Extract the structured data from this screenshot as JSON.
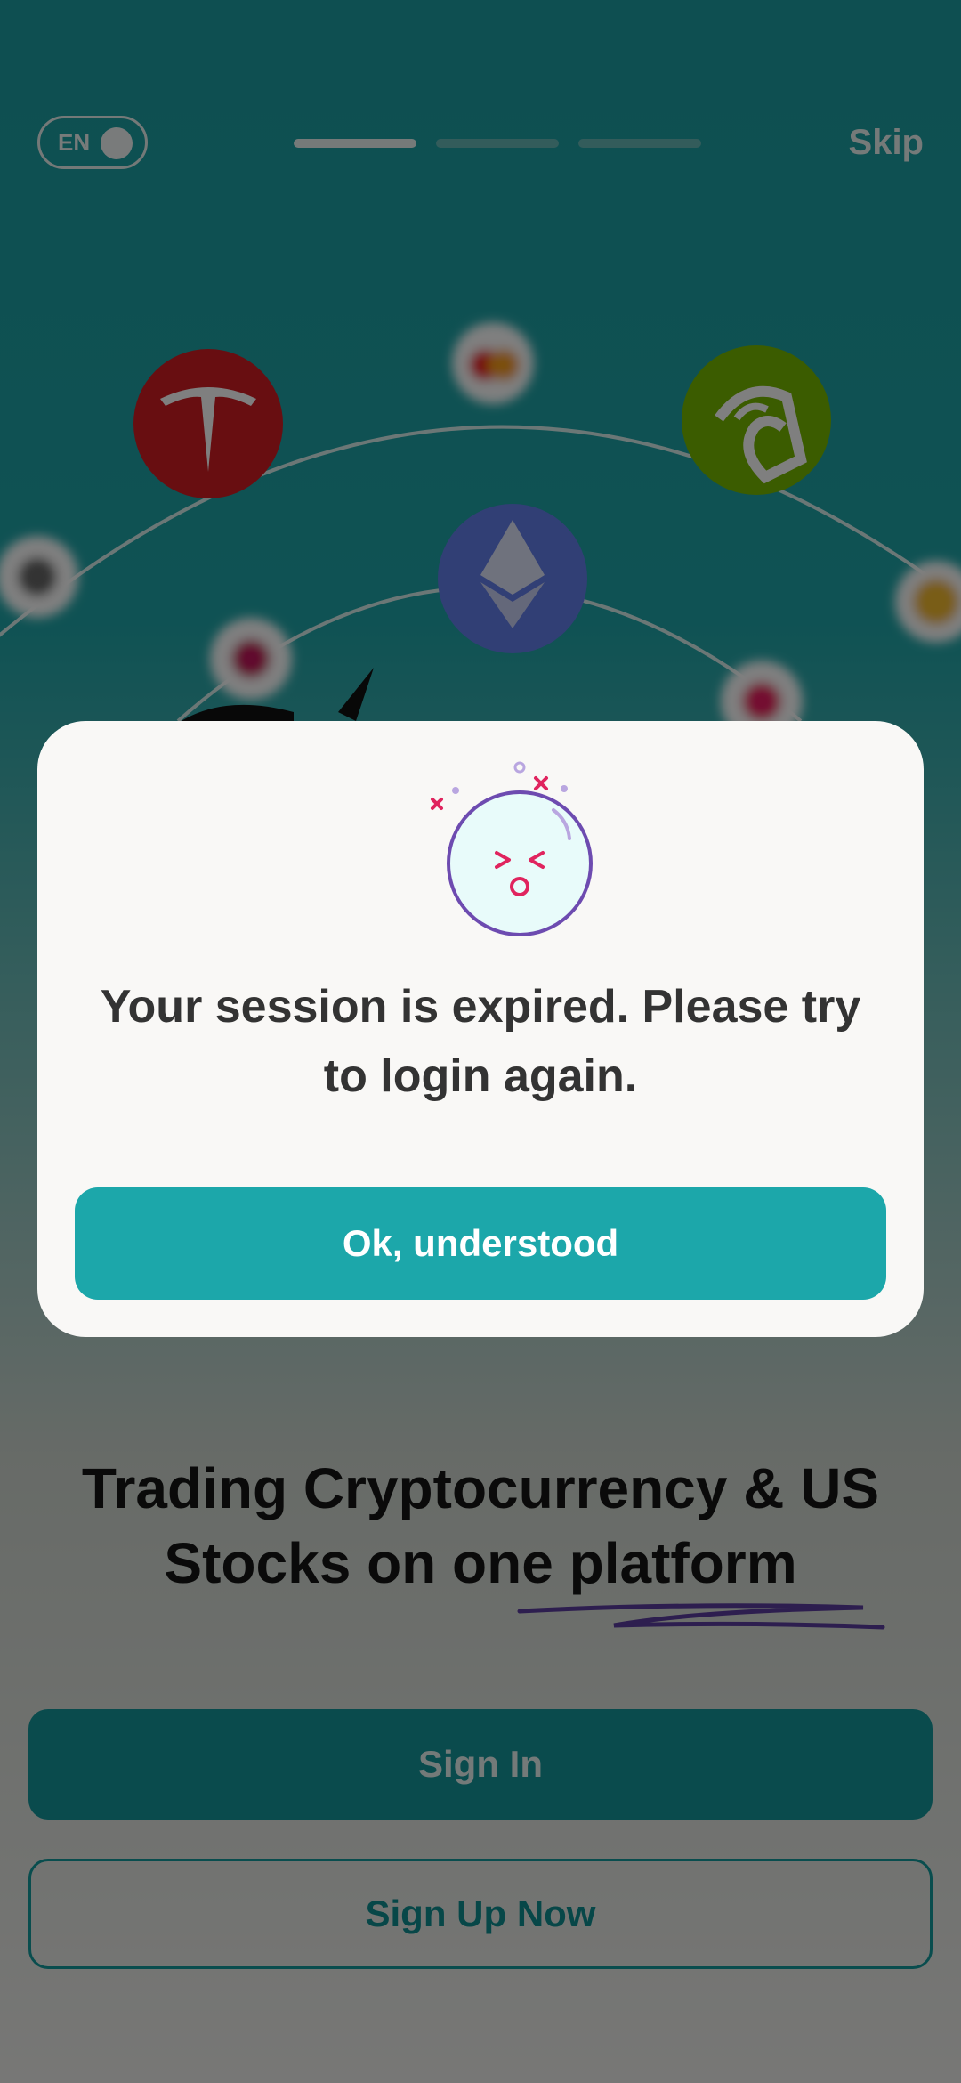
{
  "top_bar": {
    "language": "EN",
    "skip_label": "Skip"
  },
  "onboarding": {
    "headline": "Trading Cryptocurrency & US Stocks on one platform",
    "signin_label": "Sign In",
    "signup_label": "Sign Up Now"
  },
  "modal": {
    "message": "Your session is expired. Please try to login again.",
    "ok_label": "Ok, understood"
  },
  "colors": {
    "accent": "#1ca7aa",
    "tesla": "#d01c22",
    "nvidia": "#76b900",
    "ethereum": "#627eea"
  },
  "icons": [
    "tesla-logo-icon",
    "nvidia-logo-icon",
    "ethereum-logo-icon",
    "mastercard-logo-icon",
    "dizzy-face-icon"
  ]
}
